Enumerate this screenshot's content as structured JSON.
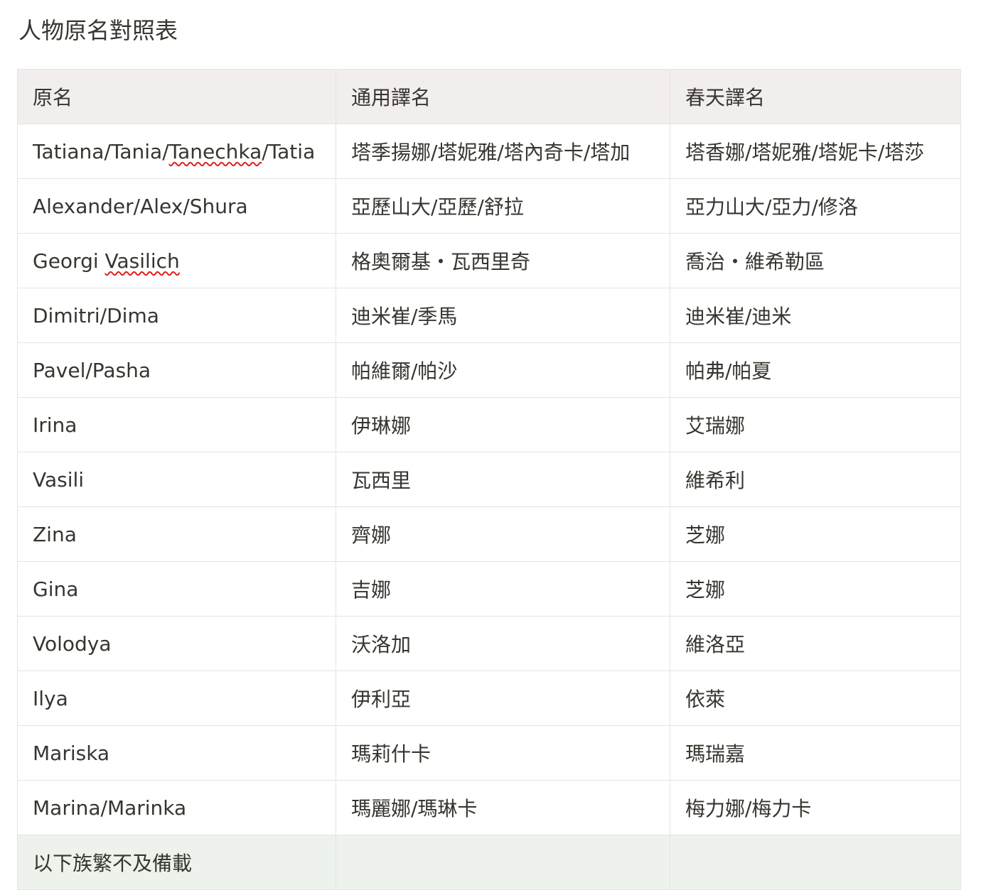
{
  "page": {
    "title": "人物原名對照表"
  },
  "table": {
    "headers": [
      "原名",
      "通用譯名",
      "春天譯名"
    ],
    "rows": [
      {
        "original_parts": [
          "Tatiana/Tania/",
          "Tanechka",
          "/Tatia"
        ],
        "common": "塔季揚娜/塔妮雅/塔內奇卡/塔加",
        "spring": "塔香娜/塔妮雅/塔妮卡/塔莎"
      },
      {
        "original": "Alexander/Alex/Shura",
        "common": "亞歷山大/亞歷/舒拉",
        "spring": "亞力山大/亞力/修洛"
      },
      {
        "original_parts": [
          "Georgi ",
          "Vasilich"
        ],
        "common": "格奧爾基・瓦西里奇",
        "spring": "喬治・維希勒區"
      },
      {
        "original": "Dimitri/Dima",
        "common": "迪米崔/季馬",
        "spring": "迪米崔/迪米"
      },
      {
        "original": "Pavel/Pasha",
        "common": "帕維爾/帕沙",
        "spring": "帕弗/帕夏"
      },
      {
        "original": "Irina",
        "common": "伊琳娜",
        "spring": "艾瑞娜"
      },
      {
        "original": "Vasili",
        "common": "瓦西里",
        "spring": "維希利"
      },
      {
        "original": "Zina",
        "common": "齊娜",
        "spring": "芝娜"
      },
      {
        "original": "Gina",
        "common": "吉娜",
        "spring": "芝娜"
      },
      {
        "original": "Volodya",
        "common": "沃洛加",
        "spring": "維洛亞"
      },
      {
        "original": "Ilya",
        "common": "伊利亞",
        "spring": "依萊"
      },
      {
        "original": "Mariska",
        "common": "瑪莉什卡",
        "spring": "瑪瑞嘉"
      },
      {
        "original": "Marina/Marinka",
        "common": "瑪麗娜/瑪琳卡",
        "spring": "梅力娜/梅力卡"
      }
    ],
    "footer": [
      "以下族繁不及備載",
      "",
      ""
    ]
  },
  "colors": {
    "text": "#37352f",
    "header_bg": "#f3eeee",
    "footer_bg": "#edf3ec",
    "border": "#e6e4e0",
    "spellcheck": "#e02020"
  }
}
